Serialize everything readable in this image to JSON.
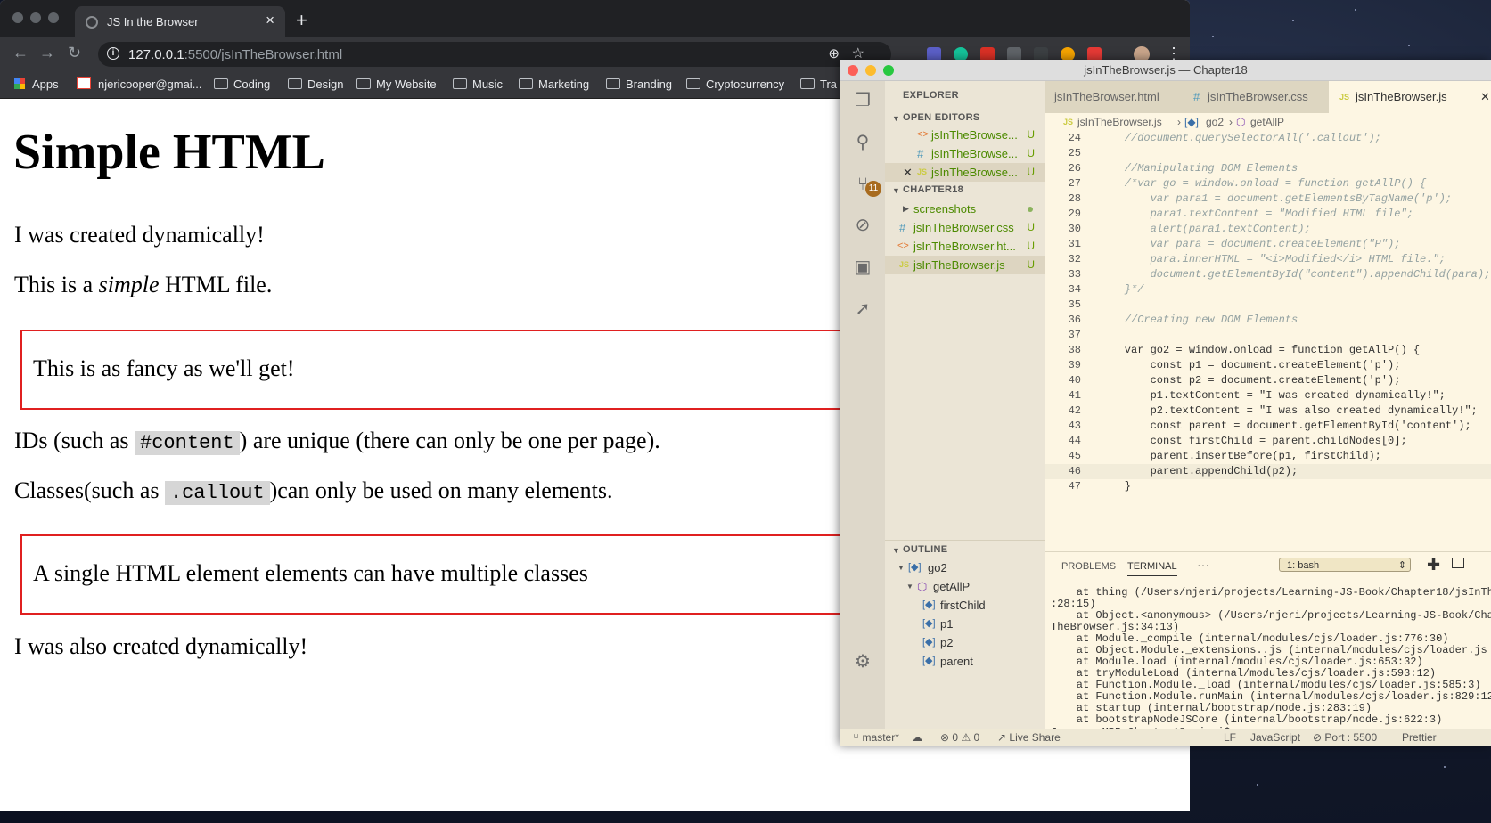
{
  "browser": {
    "tab_title": "JS In the Browser",
    "tab_close": "×",
    "new_tab": "+",
    "url_host": "127.0.0.1",
    "url_rest": ":5500/jsInTheBrowser.html",
    "bookmarks": [
      "Apps",
      "njericooper@gmai...",
      "Coding",
      "Design",
      "My Website",
      "Music",
      "Marketing",
      "Branding",
      "Cryptocurrency",
      "Tra"
    ]
  },
  "page": {
    "heading": "Simple HTML",
    "p1": "I was created dynamically!",
    "p2_before": "This is a ",
    "p2_em": "simple",
    "p2_after": " HTML file.",
    "callout1": "This is as fancy as we'll get!",
    "ids_before": "IDs (such as ",
    "ids_code": "#content",
    "ids_after": ") are unique (there can only be one per page).",
    "classes_before": "Classes(such as ",
    "classes_code": ".callout",
    "classes_after": ")can only be used on many elements.",
    "callout2": "A single HTML element elements can have multiple classes",
    "p_last": "I was also created dynamically!"
  },
  "vscode": {
    "title": "jsInTheBrowser.js — Chapter18",
    "scm_badge": "11",
    "explorer_label": "EXPLORER",
    "open_editors_label": "OPEN EDITORS",
    "open_editors": [
      "jsInTheBrowse...",
      "jsInTheBrowse...",
      "jsInTheBrowse..."
    ],
    "folder_label": "CHAPTER18",
    "files": [
      "screenshots",
      "jsInTheBrowser.css",
      "jsInTheBrowser.ht...",
      "jsInTheBrowser.js"
    ],
    "untracked_mark": "U",
    "outline_label": "OUTLINE",
    "outline": [
      "go2",
      "getAllP",
      "firstChild",
      "p1",
      "p2",
      "parent"
    ],
    "tabs": [
      "jsInTheBrowser.html",
      "jsInTheBrowser.css",
      "jsInTheBrowser.js"
    ],
    "breadcrumbs": [
      "jsInTheBrowser.js",
      "go2",
      "getAllP"
    ],
    "code": [
      {
        "n": "24",
        "t": "    //document.querySelectorAll('.callout');"
      },
      {
        "n": "25",
        "t": ""
      },
      {
        "n": "26",
        "t": "    //Manipulating DOM Elements"
      },
      {
        "n": "27",
        "t": "    /*var go = window.onload = function getAllP() {"
      },
      {
        "n": "28",
        "t": "        var para1 = document.getElementsByTagName('p');"
      },
      {
        "n": "29",
        "t": "        para1.textContent = \"Modified HTML file\";"
      },
      {
        "n": "30",
        "t": "        alert(para1.textContent);"
      },
      {
        "n": "31",
        "t": "        var para = document.createElement(\"P\");"
      },
      {
        "n": "32",
        "t": "        para.innerHTML = \"<i>Modified</i> HTML file.\";"
      },
      {
        "n": "33",
        "t": "        document.getElementById(\"content\").appendChild(para);"
      },
      {
        "n": "34",
        "t": "    }*/"
      },
      {
        "n": "35",
        "t": ""
      },
      {
        "n": "36",
        "t": "    //Creating new DOM Elements"
      },
      {
        "n": "37",
        "t": ""
      },
      {
        "n": "38",
        "t": "    var go2 = window.onload = function getAllP() {"
      },
      {
        "n": "39",
        "t": "        const p1 = document.createElement('p');"
      },
      {
        "n": "40",
        "t": "        const p2 = document.createElement('p');"
      },
      {
        "n": "41",
        "t": "        p1.textContent = \"I was created dynamically!\";"
      },
      {
        "n": "42",
        "t": "        p2.textContent = \"I was also created dynamically!\";"
      },
      {
        "n": "43",
        "t": "        const parent = document.getElementById('content');"
      },
      {
        "n": "44",
        "t": "        const firstChild = parent.childNodes[0];"
      },
      {
        "n": "45",
        "t": "        parent.insertBefore(p1, firstChild);"
      },
      {
        "n": "46",
        "t": "        parent.appendChild(p2);"
      },
      {
        "n": "47",
        "t": "    }"
      }
    ],
    "panel_tabs": [
      "PROBLEMS",
      "TERMINAL",
      "···"
    ],
    "terminal_select": "1: bash",
    "terminal": [
      "    at thing (/Users/njeri/projects/Learning-JS-Book/Chapter18/jsInTh",
      ":28:15)",
      "    at Object.<anonymous> (/Users/njeri/projects/Learning-JS-Book/Cha",
      "TheBrowser.js:34:13)",
      "    at Module._compile (internal/modules/cjs/loader.js:776:30)",
      "    at Object.Module._extensions..js (internal/modules/cjs/loader.js",
      "    at Module.load (internal/modules/cjs/loader.js:653:32)",
      "    at tryModuleLoad (internal/modules/cjs/loader.js:593:12)",
      "    at Function.Module._load (internal/modules/cjs/loader.js:585:3)",
      "    at Function.Module.runMain (internal/modules/cjs/loader.js:829:12",
      "    at startup (internal/bootstrap/node.js:283:19)",
      "    at bootstrapNodeJSCore (internal/bootstrap/node.js:622:3)",
      "Jeromes-MBP:Chapter18 njeri$ ▯"
    ],
    "status": {
      "branch": "master*",
      "errors": "0",
      "warnings": "0",
      "live_share": "Live Share",
      "eol": "LF",
      "language": "JavaScript",
      "port": "Port : 5500",
      "formatter": "Prettier"
    }
  }
}
